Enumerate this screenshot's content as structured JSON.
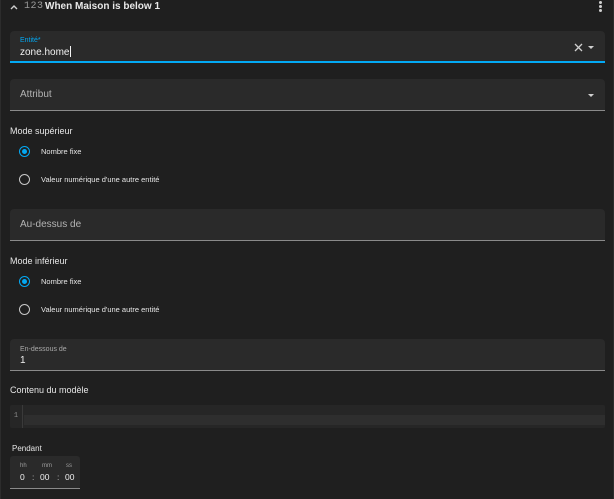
{
  "header": {
    "type_icon": "123",
    "title": "When Maison is below 1",
    "collapse_icon": "chevron-up-icon",
    "menu_icon": "dots-vertical-icon"
  },
  "entity_field": {
    "label": "Entité*",
    "value": "zone.home",
    "clear_icon": "close-icon",
    "dropdown_icon": "menu-down-icon"
  },
  "attribute_field": {
    "placeholder": "Attribut",
    "dropdown_icon": "menu-down-icon"
  },
  "upper_mode": {
    "title": "Mode supérieur",
    "options": [
      {
        "label": "Nombre fixe",
        "checked": true
      },
      {
        "label": "Valeur numérique d'une autre entité",
        "checked": false
      }
    ]
  },
  "above_field": {
    "placeholder": "Au-dessus de"
  },
  "lower_mode": {
    "title": "Mode inférieur",
    "options": [
      {
        "label": "Nombre fixe",
        "checked": true
      },
      {
        "label": "Valeur numérique d'une autre entité",
        "checked": false
      }
    ]
  },
  "below_field": {
    "label": "En-dessous de",
    "value": "1"
  },
  "template": {
    "title": "Contenu du modèle",
    "line_number": "1"
  },
  "duration": {
    "title": "Pendant",
    "hh_label": "hh",
    "mm_label": "mm",
    "ss_label": "ss",
    "hh_value": "0",
    "mm_value": "00",
    "ss_value": "00",
    "separator": ":"
  },
  "colors": {
    "accent": "#03a9f4",
    "background": "#1f1f1f",
    "field": "#2a2a2a"
  }
}
